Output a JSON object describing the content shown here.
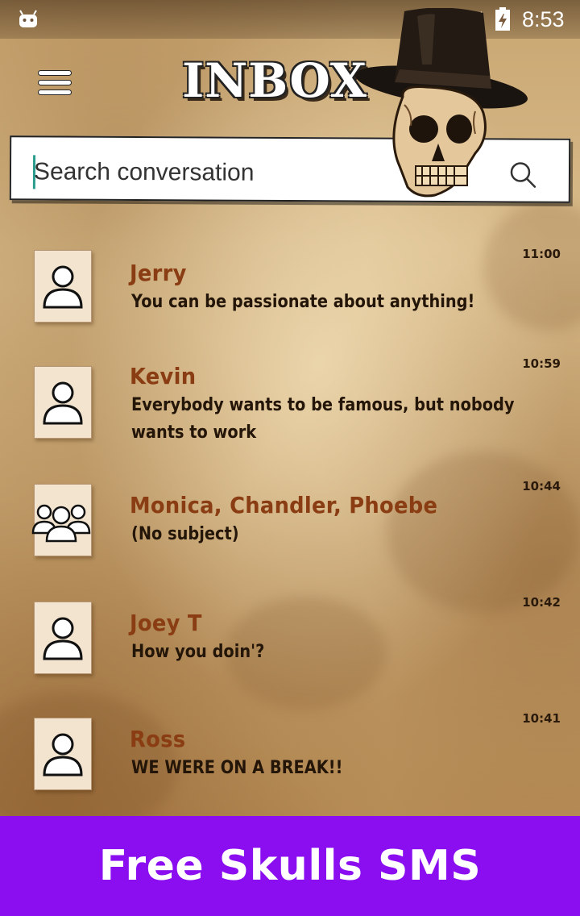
{
  "status_bar": {
    "time": "8:53"
  },
  "header": {
    "title": "INBOX"
  },
  "search": {
    "placeholder": "Search conversation"
  },
  "conversations": [
    {
      "name": "Jerry",
      "message": "You can be passionate about anything!",
      "time": "11:00",
      "avatar": "person-icon"
    },
    {
      "name": "Kevin",
      "message": "Everybody wants to be famous, but nobody wants to work",
      "time": "10:59",
      "avatar": "person-icon"
    },
    {
      "name": "Monica, Chandler, Phoebe",
      "message": "(No subject)",
      "time": "10:44",
      "avatar": "group-icon"
    },
    {
      "name": "Joey T",
      "message": "How you doin'?",
      "time": "10:42",
      "avatar": "person-icon"
    },
    {
      "name": "Ross",
      "message": "WE WERE ON A BREAK!!",
      "time": "10:41",
      "avatar": "person-icon"
    }
  ],
  "banner": {
    "text": "Free Skulls SMS"
  },
  "colors": {
    "name": "#8a3c12",
    "banner": "#8a0ef0",
    "accent_caret": "#2a9d8f"
  }
}
